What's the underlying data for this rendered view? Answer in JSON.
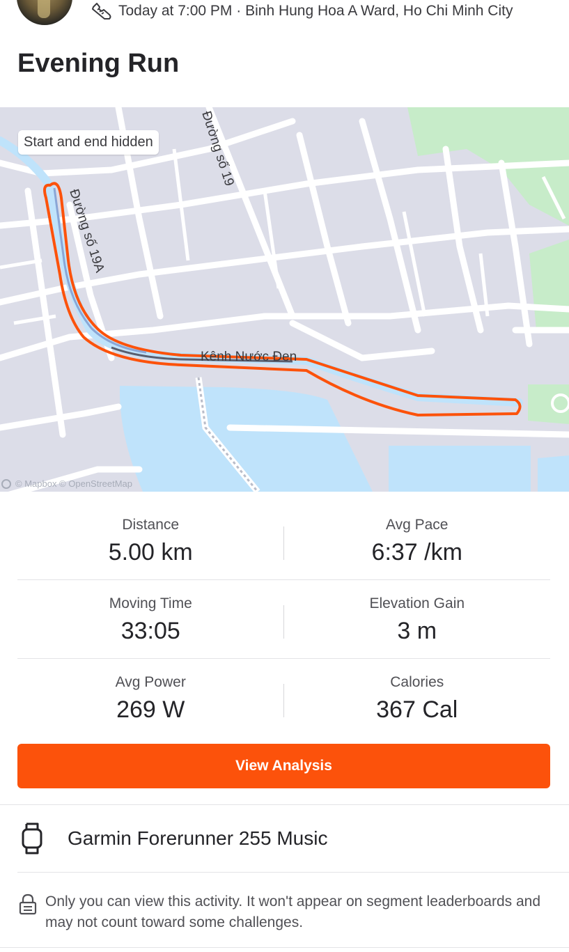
{
  "header": {
    "timestamp_location": "Today at 7:00 PM · Binh Hung Hoa A Ward, Ho Chi Minh City"
  },
  "activity": {
    "title": "Evening Run"
  },
  "map": {
    "privacy_chip": "Start and end hidden",
    "street_labels": [
      "Đường số 19A",
      "Đường số 19",
      "Kênh Nước Đen"
    ],
    "attribution": "© Mapbox © OpenStreetMap",
    "route_color": "#fc520b",
    "water_color": "#bfe3fb",
    "park_color": "#c7ecc9"
  },
  "stats": [
    {
      "label": "Distance",
      "value": "5.00 km"
    },
    {
      "label": "Avg Pace",
      "value": "6:37 /km"
    },
    {
      "label": "Moving Time",
      "value": "33:05"
    },
    {
      "label": "Elevation Gain",
      "value": "3 m"
    },
    {
      "label": "Avg Power",
      "value": "269 W"
    },
    {
      "label": "Calories",
      "value": "367 Cal"
    }
  ],
  "actions": {
    "view_analysis": "View Analysis"
  },
  "device": {
    "name": "Garmin Forerunner 255 Music",
    "icon": "watch-icon"
  },
  "privacy": {
    "icon": "lock-icon",
    "text": "Only you can view this activity. It won't appear on segment leaderboards and may not count toward some challenges."
  },
  "colors": {
    "accent": "#fc520b",
    "text_primary": "#242428",
    "text_secondary": "#505055"
  }
}
